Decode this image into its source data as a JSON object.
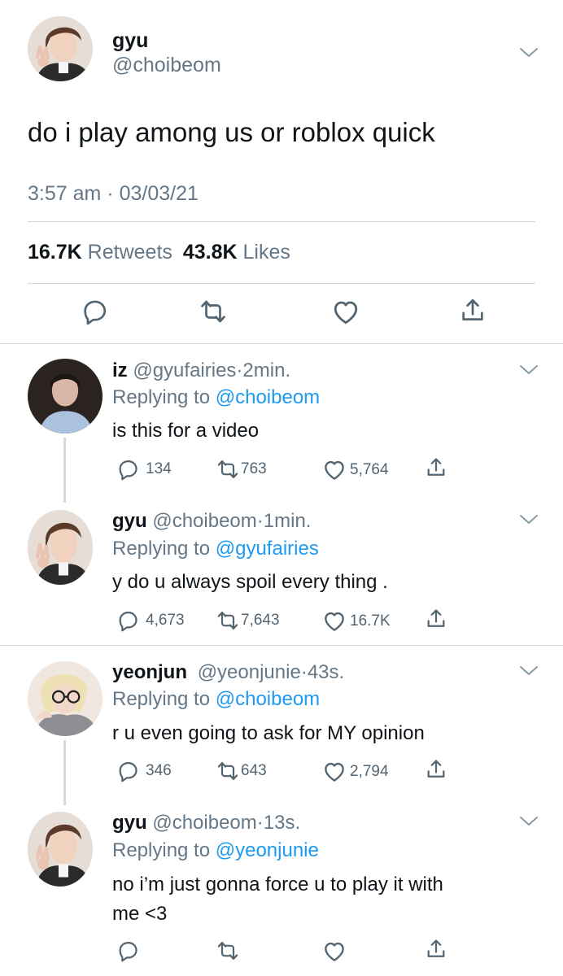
{
  "main_tweet": {
    "display_name": "gyu",
    "handle": "@choibeom",
    "text": "do i play among us or roblox quick",
    "time": "3:57 am",
    "date": "03/03/21",
    "retweets_count": "16.7K",
    "retweets_label": "Retweets",
    "likes_count": "43.8K",
    "likes_label": "Likes"
  },
  "replies": [
    {
      "display_name": "iz",
      "handle": "@gyufairies",
      "age": "2min.",
      "replying_label": "Replying to",
      "replying_to": "@choibeom",
      "text": "is this for a video",
      "replies": "134",
      "retweets": "763",
      "likes": "5,764"
    },
    {
      "display_name": "gyu",
      "handle": "@choibeom",
      "age": "1min.",
      "replying_label": "Replying to",
      "replying_to": "@gyufairies",
      "text": "y do u always spoil every thing .",
      "replies": "4,673",
      "retweets": "7,643",
      "likes": "16.7K"
    },
    {
      "display_name": "yeonjun",
      "handle": "@yeonjunie",
      "age": "43s.",
      "replying_label": "Replying to",
      "replying_to": "@choibeom",
      "text": "r u even going to ask for MY opinion",
      "replies": "346",
      "retweets": "643",
      "likes": "2,794"
    },
    {
      "display_name": "gyu",
      "handle": "@choibeom",
      "age": "13s.",
      "replying_label": "Replying to",
      "replying_to": "@yeonjunie",
      "text_line1": "no i’m just gonna force u to play it with",
      "text_line2": "me <3"
    }
  ],
  "separator": "·",
  "icons": [
    "chevron-down-icon",
    "reply-icon",
    "retweet-icon",
    "like-icon",
    "share-icon"
  ],
  "colors": {
    "link": "#1d9bf0",
    "secondary": "#657786",
    "divider": "#cfd9de"
  }
}
